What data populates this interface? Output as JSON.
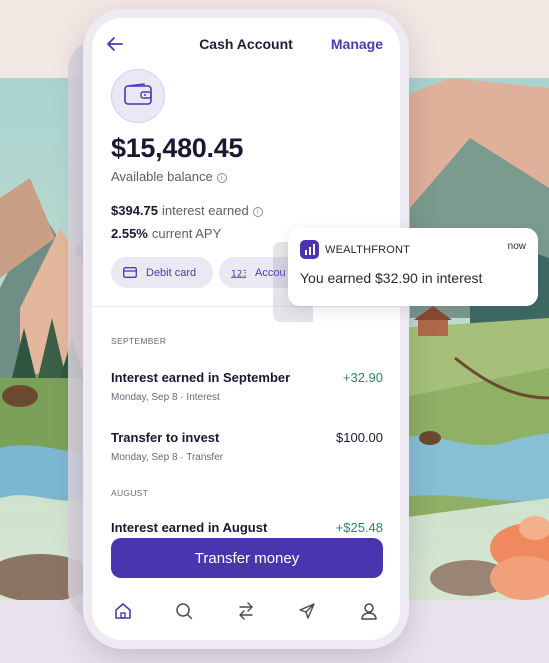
{
  "header": {
    "title": "Cash Account",
    "manage_label": "Manage"
  },
  "account": {
    "balance": "$15,480.45",
    "balance_label": "Available balance",
    "interest_amount": "$394.75",
    "interest_label": "interest earned",
    "apy_value": "2.55%",
    "apy_label": "current APY"
  },
  "actions": {
    "debit_card_label": "Debit card",
    "account_label": "Accou"
  },
  "activity": {
    "sections": [
      {
        "label": "SEPTEMBER",
        "items": [
          {
            "title": "Interest earned in September",
            "subtitle": "Monday, Sep 8 · Interest",
            "amount": "+32.90"
          },
          {
            "title": "Transfer to invest",
            "subtitle": "Monday, Sep 8 · Transfer",
            "amount": "$100.00"
          }
        ]
      },
      {
        "label": "AUGUST",
        "items": [
          {
            "title": "Interest earned in August",
            "amount": "+$25.48"
          }
        ]
      }
    ]
  },
  "cta": {
    "label": "Transfer money"
  },
  "bottom_nav": {
    "items": [
      {
        "icon": "home-icon",
        "active": true
      },
      {
        "icon": "search-icon"
      },
      {
        "icon": "transfer-icon"
      },
      {
        "icon": "send-icon"
      },
      {
        "icon": "profile-icon"
      }
    ]
  },
  "notification": {
    "brand": "WEALTHFRONT",
    "time": "now",
    "message": "You earned $32.90 in interest"
  },
  "colors": {
    "accent": "#4a35ae",
    "positive": "#2a8a5a",
    "text_primary": "#1a1730"
  }
}
